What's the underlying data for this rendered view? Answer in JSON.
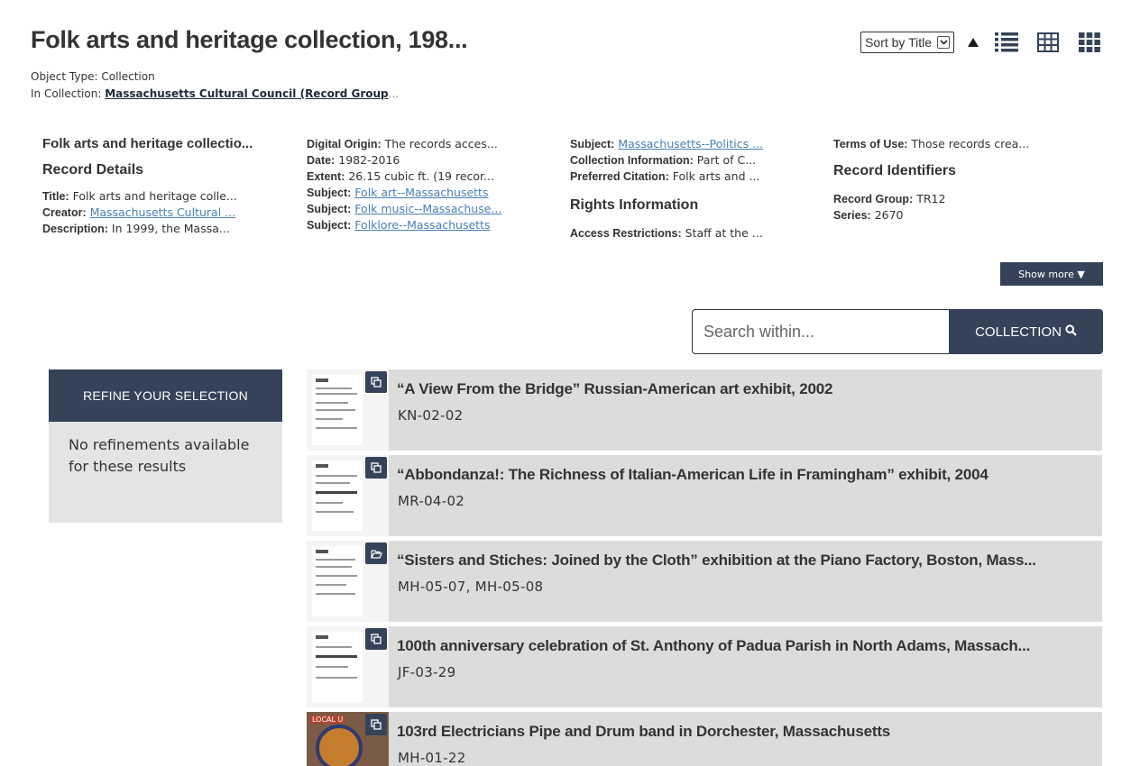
{
  "header": {
    "title": "Folk arts and heritage collection, 198...",
    "object_type_label": "Object Type:",
    "object_type_value": "Collection",
    "in_collection_label": "In Collection:",
    "in_collection_value": "Massachusetts Cultural Council (Record Group",
    "in_collection_ellipsis": "..."
  },
  "toolbar": {
    "sort_selected": "Sort by Title",
    "sort_direction_icon": "triangle-up",
    "views": [
      "list-view-icon",
      "table-view-icon",
      "grid-view-icon"
    ]
  },
  "details": {
    "col1": {
      "title": "Folk arts and heritage collectio...",
      "heading": "Record Details",
      "rows": [
        {
          "label": "Title:",
          "value": "Folk arts and heritage colle..."
        },
        {
          "label": "Creator:",
          "value": "Massachusetts Cultural ..."
        },
        {
          "label": "Description:",
          "value": "In 1999, the Massa..."
        }
      ]
    },
    "col2": {
      "rows": [
        {
          "label": "Digital Origin:",
          "value": "The records acces..."
        },
        {
          "label": "Date:",
          "value": "1982-2016"
        },
        {
          "label": "Extent:",
          "value": "26.15 cubic ft. (19 recor..."
        },
        {
          "label": "Subject:",
          "value": "Folk art--Massachusetts"
        },
        {
          "label": "Subject:",
          "value": "Folk music--Massachuse..."
        },
        {
          "label": "Subject:",
          "value": "Folklore--Massachusetts"
        }
      ]
    },
    "col3": {
      "rows": [
        {
          "label": "Subject:",
          "value": "Massachusetts--Politics ..."
        },
        {
          "label": "Collection Information:",
          "value": "Part of C..."
        },
        {
          "label": "Preferred Citation:",
          "value": "Folk arts and ..."
        }
      ],
      "heading": "Rights Information",
      "rows2": [
        {
          "label": "Access Restrictions:",
          "value": "Staff at the ..."
        }
      ]
    },
    "col4": {
      "rows": [
        {
          "label": "Terms of Use:",
          "value": "Those records crea..."
        }
      ],
      "heading": "Record Identifiers",
      "rows2": [
        {
          "label": "Record Group:",
          "value": "TR12"
        },
        {
          "label": "Series:",
          "value": "2670"
        }
      ]
    },
    "show_more": "Show more ▼"
  },
  "search": {
    "placeholder": "Search within...",
    "button_label": "COLLECTION"
  },
  "refine": {
    "heading": "REFINE YOUR SELECTION",
    "body": "No refinements available for these results"
  },
  "results": [
    {
      "title": "“A View From the Bridge” Russian-American art exhibit, 2002",
      "id": "KN-02-02",
      "badge": "copy-icon"
    },
    {
      "title": "“Abbondanza!: The Richness of Italian-American Life in Framingham” exhibit, 2004",
      "id": "MR-04-02",
      "badge": "copy-icon"
    },
    {
      "title": "“Sisters and Stiches: Joined by the Cloth” exhibition at the Piano Factory, Boston, Mass...",
      "id": "MH-05-07, MH-05-08",
      "badge": "folder-open-icon"
    },
    {
      "title": "100th anniversary celebration of St. Anthony of Padua Parish in North Adams, Massach...",
      "id": "JF-03-29",
      "badge": "copy-icon"
    },
    {
      "title": "103rd Electricians Pipe and Drum band in Dorchester, Massachusetts",
      "id": "MH-01-22",
      "badge": "copy-icon",
      "thumb_label": "LOCAL U"
    }
  ],
  "colors": {
    "accent": "#35425a",
    "panel": "#dcdcdc",
    "link": "#4a7fb5"
  }
}
